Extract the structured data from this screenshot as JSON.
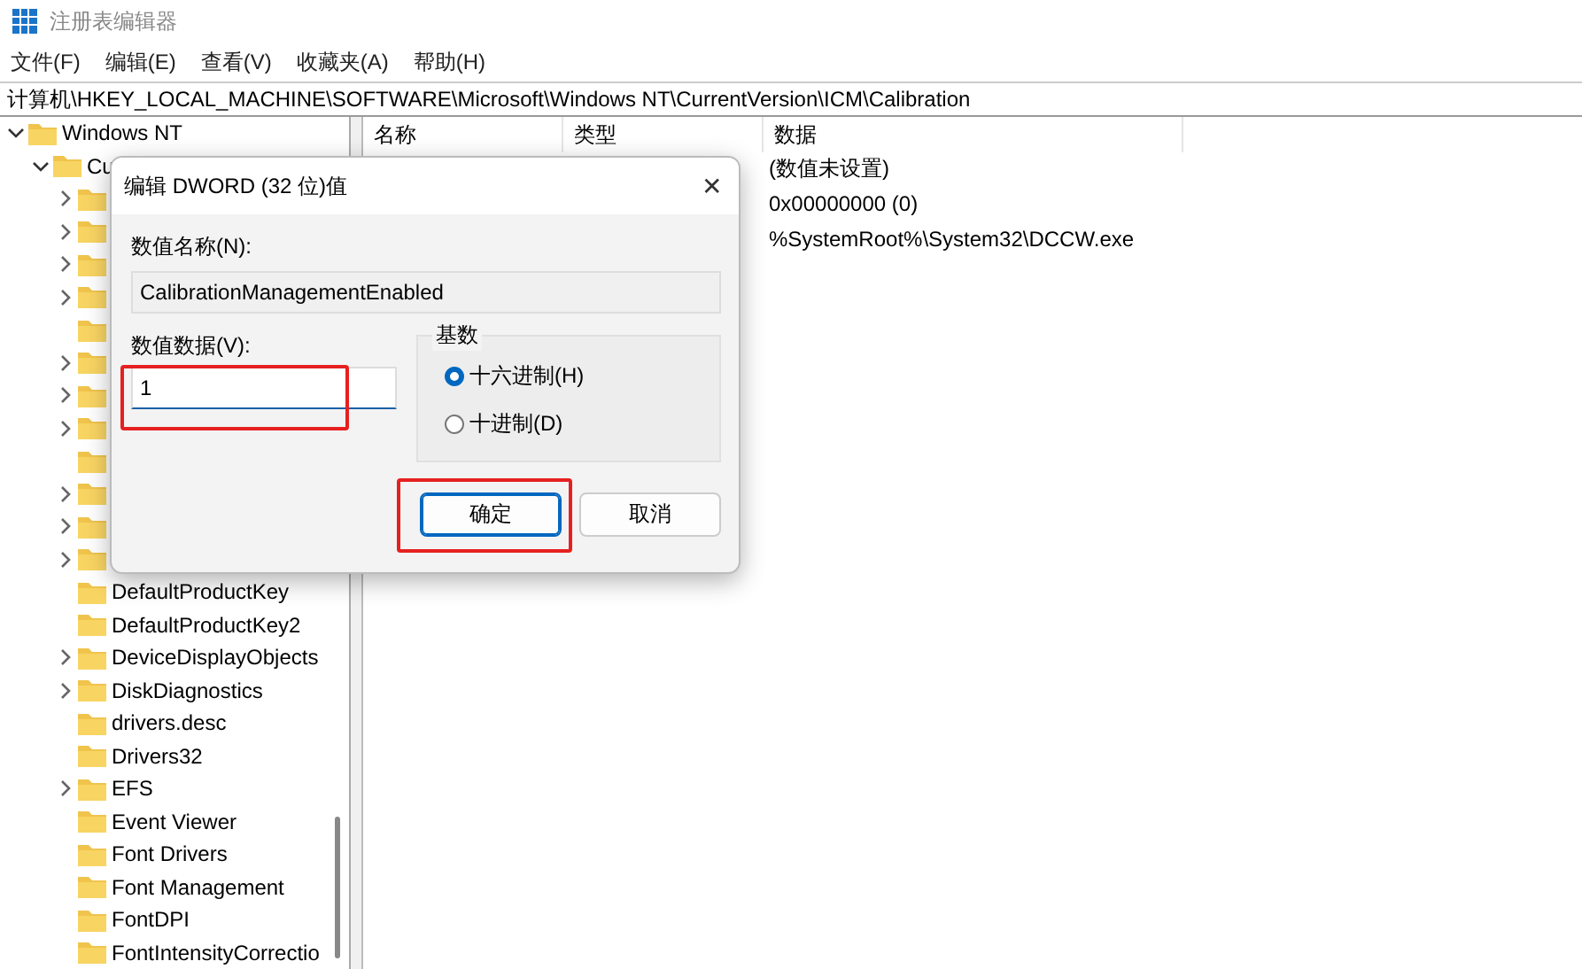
{
  "window": {
    "title": "注册表编辑器"
  },
  "menu": [
    "文件(F)",
    "编辑(E)",
    "查看(V)",
    "收藏夹(A)",
    "帮助(H)"
  ],
  "address": "计算机\\HKEY_LOCAL_MACHINE\\SOFTWARE\\Microsoft\\Windows NT\\CurrentVersion\\ICM\\Calibration",
  "tree": {
    "items": [
      {
        "label": "Windows NT",
        "expanded": true,
        "children": [
          {
            "label": "Cu",
            "expanded": true,
            "children": [
              {
                "has_children": true
              },
              {
                "has_children": true
              },
              {
                "has_children": true
              },
              {
                "has_children": true
              },
              {
                "has_children": false
              },
              {
                "has_children": true
              },
              {
                "has_children": true
              },
              {
                "has_children": true
              },
              {
                "has_children": false
              },
              {
                "has_children": true
              },
              {
                "has_children": true
              },
              {
                "has_children": true
              },
              {
                "label": "DefaultProductKey",
                "has_children": false
              },
              {
                "label": "DefaultProductKey2",
                "has_children": false
              },
              {
                "label": "DeviceDisplayObjects",
                "has_children": true
              },
              {
                "label": "DiskDiagnostics",
                "has_children": true
              },
              {
                "label": "drivers.desc",
                "has_children": false
              },
              {
                "label": "Drivers32",
                "has_children": false
              },
              {
                "label": "EFS",
                "has_children": true
              },
              {
                "label": "Event Viewer",
                "has_children": false
              },
              {
                "label": "Font Drivers",
                "has_children": false
              },
              {
                "label": "Font Management",
                "has_children": false
              },
              {
                "label": "FontDPI",
                "has_children": false
              },
              {
                "label": "FontIntensityCorrectio",
                "has_children": false
              }
            ]
          }
        ]
      }
    ]
  },
  "list": {
    "columns": [
      "名称",
      "类型",
      "数据"
    ],
    "rows": [
      {
        "data": "(数值未设置)"
      },
      {
        "data": "0x00000000 (0)"
      },
      {
        "data": "%SystemRoot%\\System32\\DCCW.exe"
      }
    ]
  },
  "dialog": {
    "title": "编辑 DWORD (32 位)值",
    "close": "✕",
    "name_label": "数值名称(N):",
    "name_value": "CalibrationManagementEnabled",
    "data_label": "数值数据(V):",
    "data_value": "1",
    "radix": {
      "title": "基数",
      "options": [
        {
          "label": "十六进制(H)",
          "selected": true
        },
        {
          "label": "十进制(D)",
          "selected": false
        }
      ]
    },
    "buttons": [
      {
        "label": "确定",
        "default": true
      },
      {
        "label": "取消",
        "default": false
      }
    ]
  }
}
